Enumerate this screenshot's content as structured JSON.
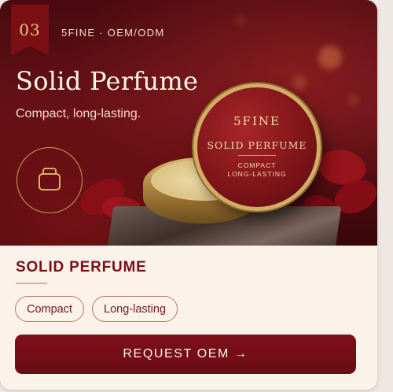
{
  "card": {
    "number": "03",
    "brand_line": "5FINE · OEM/ODM",
    "hero_title": "Solid Perfume",
    "hero_subtitle": "Compact, long-lasting.",
    "icon": "compact-tin-icon",
    "product_lid": {
      "brand": "5FINE",
      "name": "SOLID PERFUME",
      "tagline_line1": "COMPACT",
      "tagline_line2": "LONG-LASTING"
    },
    "section_title": "SOLID PERFUME",
    "tags": [
      "Compact",
      "Long-lasting"
    ],
    "cta_label": "REQUEST OEM →"
  },
  "colors": {
    "accent": "#7a0f18",
    "gold": "#c9a05a",
    "background": "#fbf2ea"
  }
}
